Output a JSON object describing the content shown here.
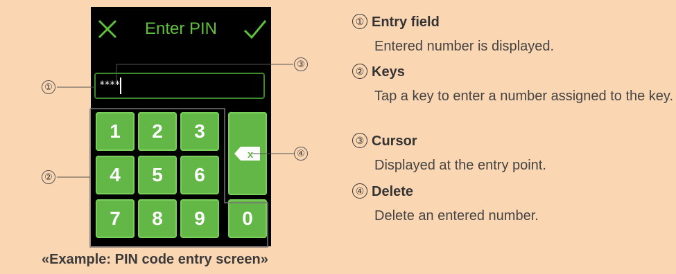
{
  "device": {
    "header": {
      "title": "Enter PIN",
      "cancel_icon": "close-icon",
      "confirm_icon": "check-icon",
      "accent": "#5fc13a"
    },
    "entry_field": {
      "value": "****"
    },
    "keypad": {
      "keys": [
        "1",
        "2",
        "3",
        "4",
        "5",
        "6",
        "7",
        "8",
        "9",
        "0"
      ],
      "delete_icon": "backspace-x-icon",
      "key_color": "#62b746"
    }
  },
  "callouts": [
    "①",
    "②",
    "③",
    "④"
  ],
  "caption": "«Example: PIN code entry screen»",
  "legend": [
    {
      "number": "①",
      "title": "Entry field",
      "description": "Entered number is displayed."
    },
    {
      "number": "②",
      "title": "Keys",
      "description": "Tap a key to enter a number assigned to the key."
    },
    {
      "number": "③",
      "title": "Cursor",
      "description": "Displayed at the entry point."
    },
    {
      "number": "④",
      "title": "Delete",
      "description": "Delete an entered number."
    }
  ]
}
